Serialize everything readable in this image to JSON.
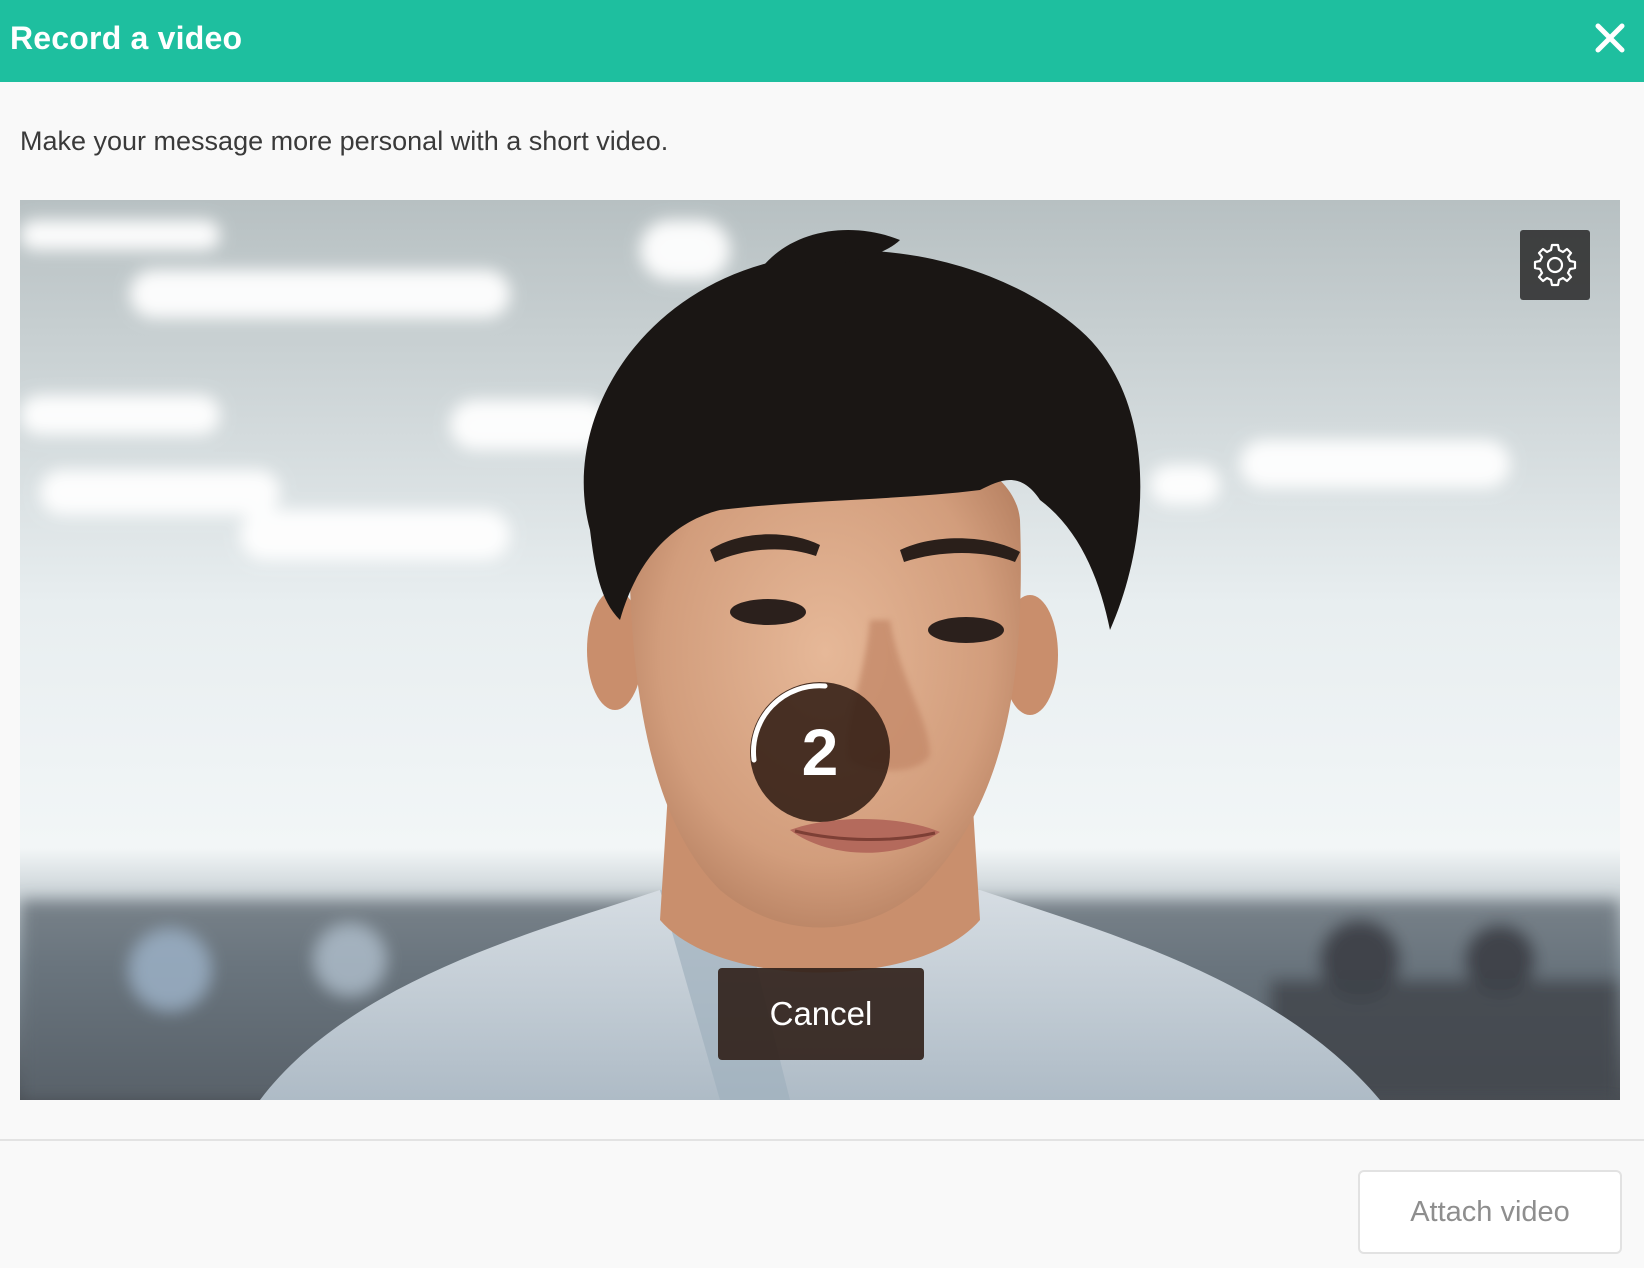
{
  "dialog": {
    "title": "Record a video",
    "subtitle": "Make your message more personal with a short video."
  },
  "video": {
    "countdown": "2",
    "cancel_label": "Cancel",
    "settings_icon": "gear-icon"
  },
  "footer": {
    "attach_label": "Attach video",
    "attach_enabled": false
  },
  "colors": {
    "header": "#1ebf9f",
    "overlay": "#32201a"
  }
}
